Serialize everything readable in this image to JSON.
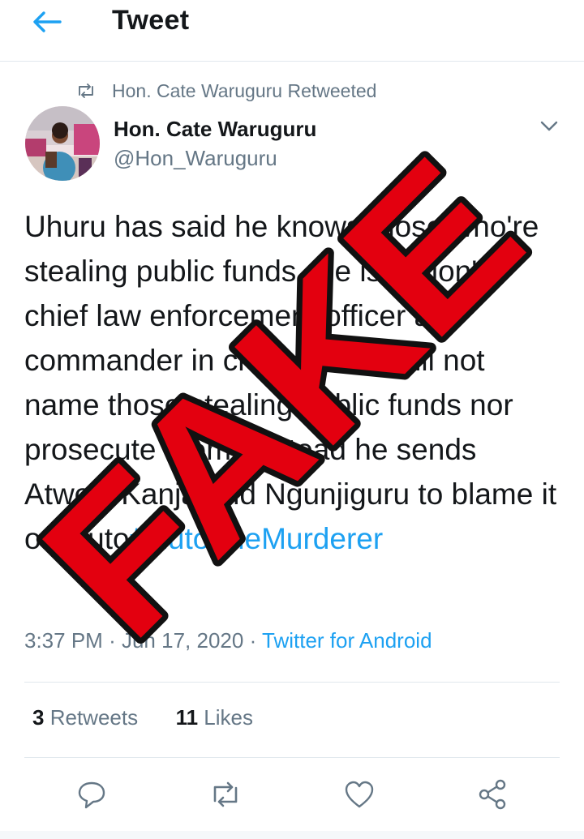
{
  "header": {
    "title": "Tweet",
    "back_icon": "arrow-left-icon"
  },
  "retweet_banner": {
    "icon": "retweet-icon",
    "text": "Hon. Cate Waruguru Retweeted"
  },
  "author": {
    "name": "Hon. Cate Waruguru",
    "handle": "@Hon_Waruguru",
    "menu_icon": "chevron-down-icon"
  },
  "tweet": {
    "text": "Uhuru has said he knows those who're stealing public funds. He is nation's chief law enforcement officer as commander in chief. Uhuru will not name those stealing public funds nor prosecute them. Instead he sends Atwoli, Kanja and Ngunjiguru to blame it on Ruto",
    "hashtag": "#RutoTheMurderer"
  },
  "meta": {
    "time": "3:37 PM",
    "separator_1": "·",
    "date": "Jun 17, 2020",
    "separator_2": "·",
    "client": "Twitter for Android"
  },
  "stats": {
    "retweets_count": "3",
    "retweets_label": "Retweets",
    "likes_count": "11",
    "likes_label": "Likes"
  },
  "actions": [
    "reply-icon",
    "retweet-icon",
    "like-icon",
    "share-icon"
  ],
  "stamp": {
    "text": "FAKE",
    "color": "#e3000f"
  },
  "colors": {
    "accent": "#1da1f2",
    "secondary_text": "#657786",
    "divider": "#e1e8ed"
  }
}
